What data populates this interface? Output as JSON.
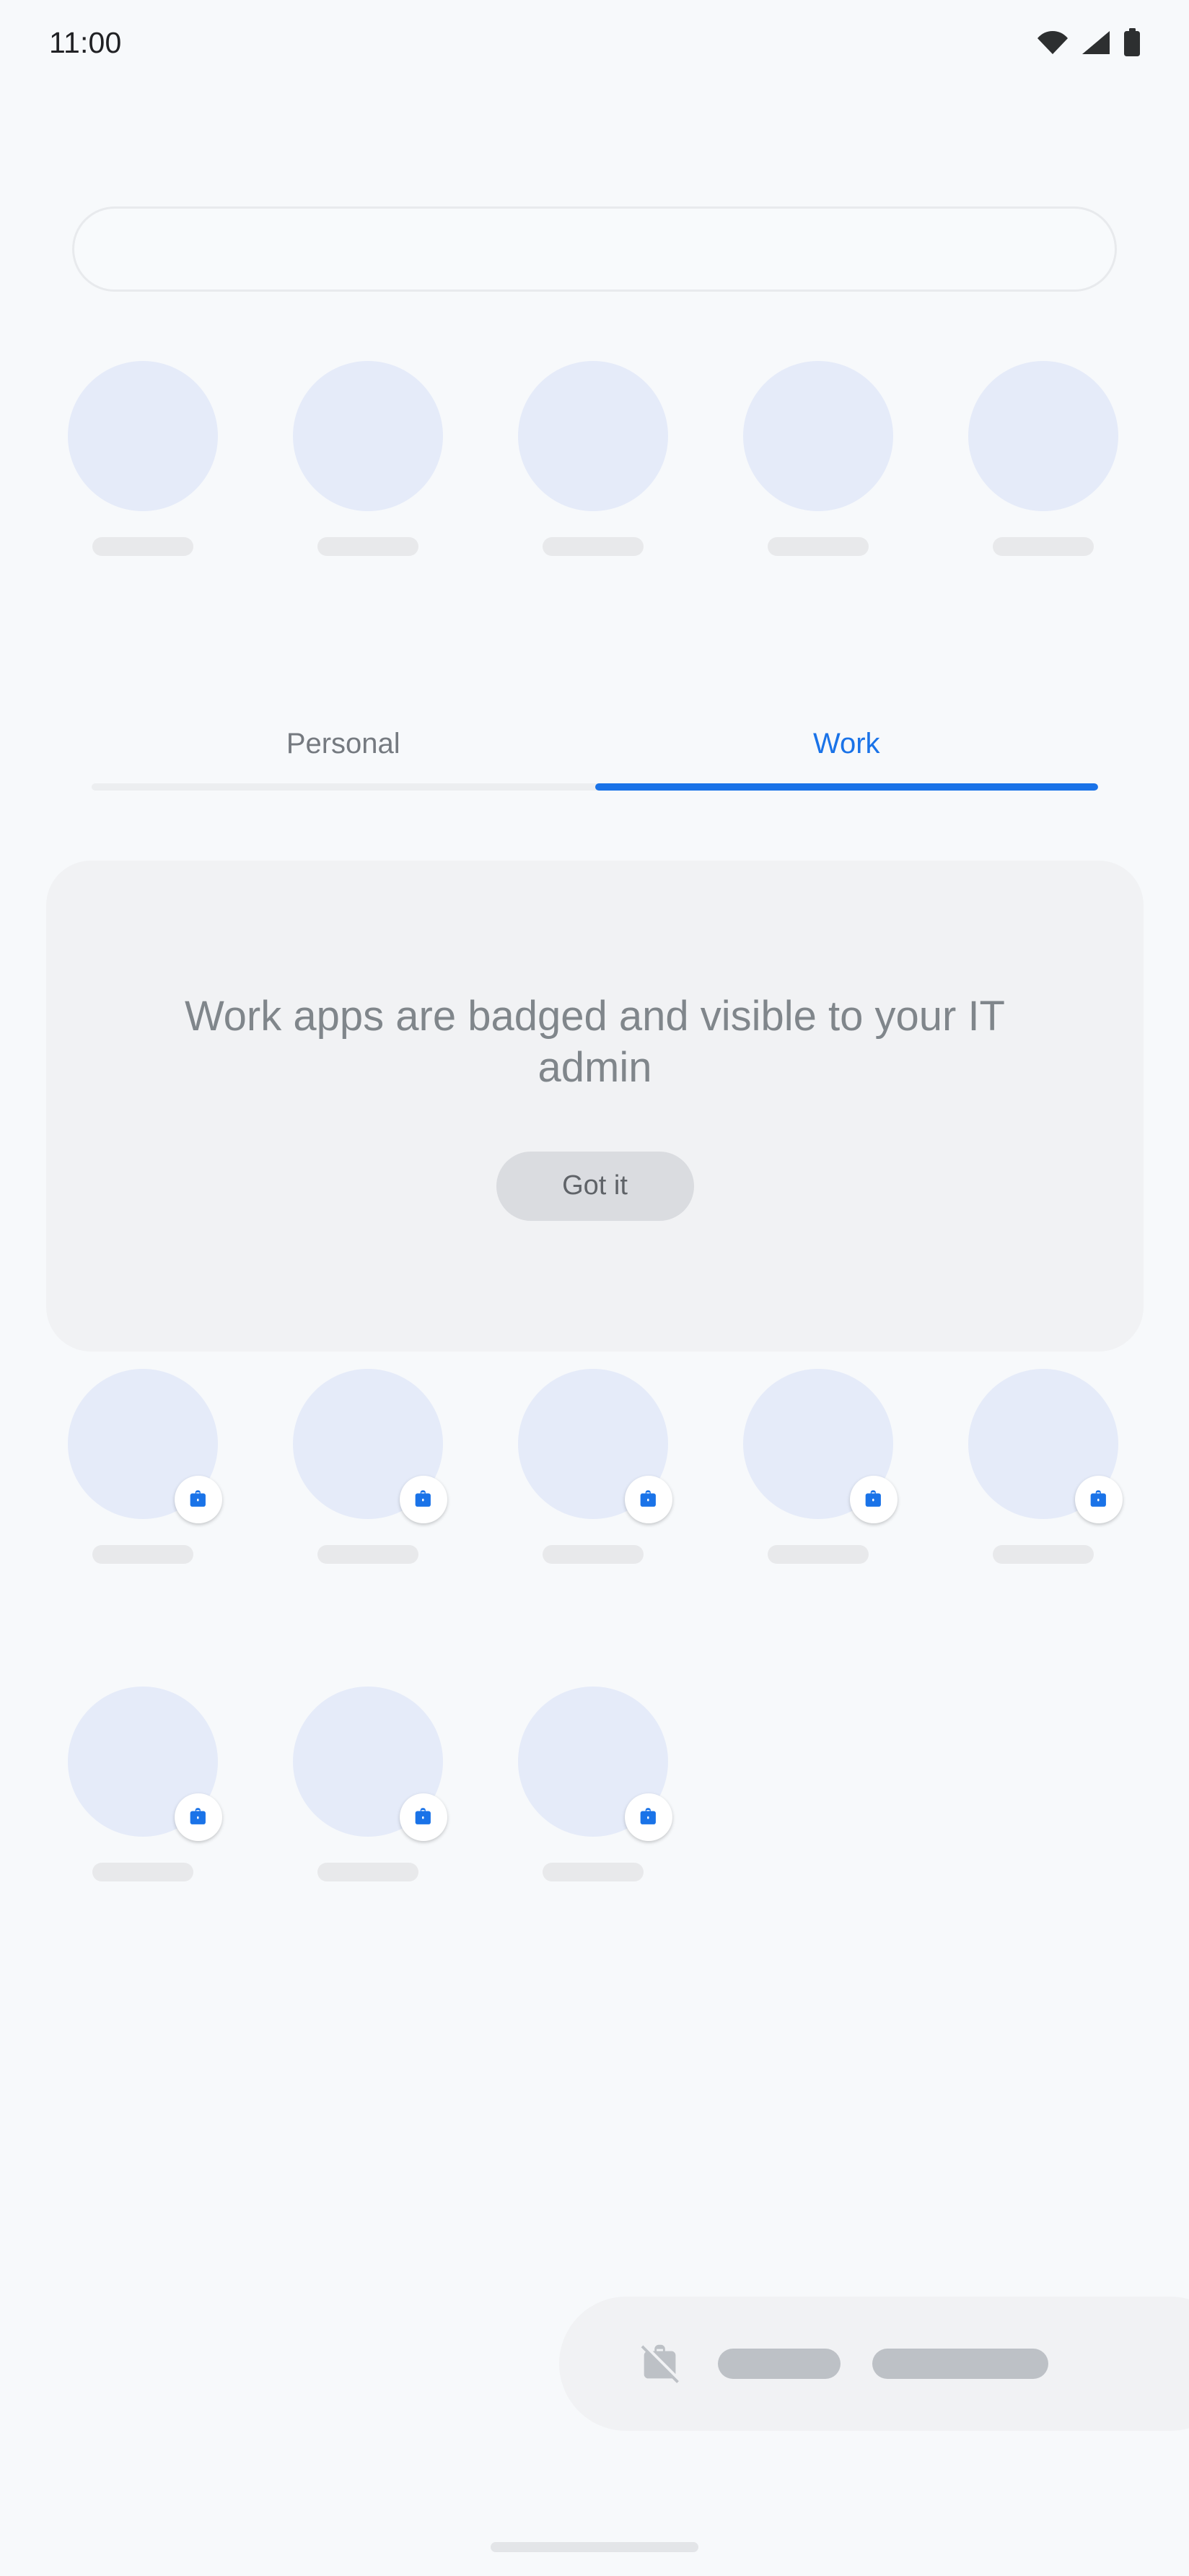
{
  "status_bar": {
    "clock": "11:00",
    "icons": [
      {
        "name": "wifi-icon",
        "label": "Wi-Fi"
      },
      {
        "name": "cellular-signal-icon",
        "label": "Cellular signal"
      },
      {
        "name": "battery-icon",
        "label": "Battery"
      }
    ]
  },
  "search": {
    "value": "",
    "placeholder": ""
  },
  "top_apps": {
    "count": 5,
    "items": [
      {
        "label": "",
        "badged": false
      },
      {
        "label": "",
        "badged": false
      },
      {
        "label": "",
        "badged": false
      },
      {
        "label": "",
        "badged": false
      },
      {
        "label": "",
        "badged": false
      }
    ]
  },
  "tabs": {
    "items": [
      {
        "label": "Personal",
        "active": false
      },
      {
        "label": "Work",
        "active": true
      }
    ],
    "active_index": 1,
    "active_color": "#1a73e8",
    "inactive_color": "#757a80"
  },
  "info_card": {
    "message": "Work apps are badged and visible to your IT admin",
    "button_label": "Got it"
  },
  "work_apps": {
    "row1": [
      {
        "label": "",
        "badge": "work-briefcase-badge"
      },
      {
        "label": "",
        "badge": "work-briefcase-badge"
      },
      {
        "label": "",
        "badge": "work-briefcase-badge"
      },
      {
        "label": "",
        "badge": "work-briefcase-badge"
      },
      {
        "label": "",
        "badge": "work-briefcase-badge"
      }
    ],
    "row2": [
      {
        "label": "",
        "badge": "work-briefcase-badge"
      },
      {
        "label": "",
        "badge": "work-briefcase-badge"
      },
      {
        "label": "",
        "badge": "work-briefcase-badge"
      }
    ]
  },
  "bottom_dock": {
    "icon": "work-profile-off-icon",
    "items": [
      {
        "label": ""
      },
      {
        "label": ""
      }
    ]
  },
  "navigation": {
    "handle": "gesture-nav-handle"
  },
  "colors": {
    "background": "#f7f9fb",
    "accent": "#1a73e8",
    "app_icon_placeholder": "#e5ebf9",
    "card_background": "#f1f2f4",
    "skeleton": "#e8e9eb",
    "dock_skeleton": "#bdc1c6"
  }
}
